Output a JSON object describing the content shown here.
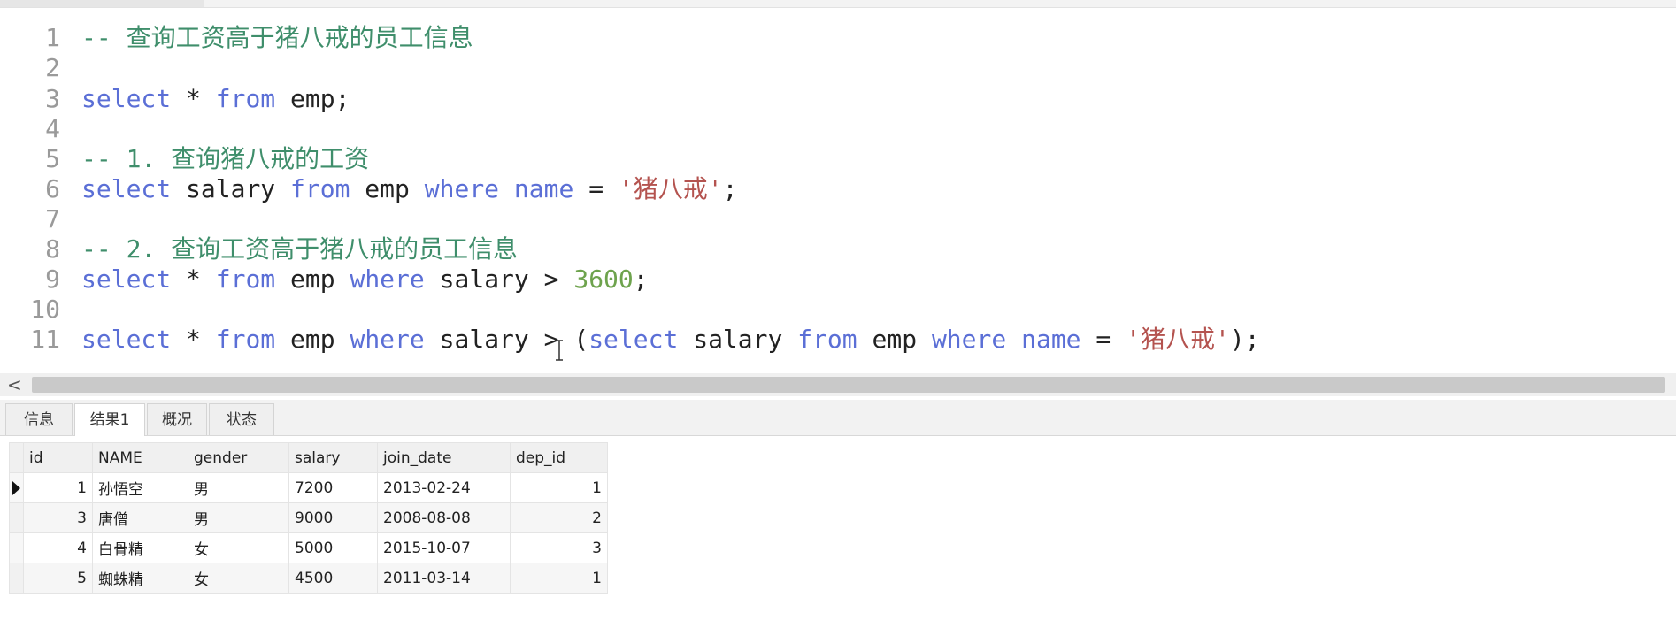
{
  "editor": {
    "lines": [
      {
        "num": "1",
        "tokens": [
          {
            "cls": "cm",
            "text": "-- 查询工资高于猪八戒的员工信息"
          }
        ]
      },
      {
        "num": "2",
        "tokens": []
      },
      {
        "num": "3",
        "tokens": [
          {
            "cls": "kw",
            "text": "select"
          },
          {
            "cls": "tx",
            "text": " * "
          },
          {
            "cls": "kw",
            "text": "from"
          },
          {
            "cls": "tx",
            "text": " emp;"
          }
        ]
      },
      {
        "num": "4",
        "tokens": []
      },
      {
        "num": "5",
        "tokens": [
          {
            "cls": "cm",
            "text": "-- 1. 查询猪八戒的工资"
          }
        ]
      },
      {
        "num": "6",
        "tokens": [
          {
            "cls": "kw",
            "text": "select"
          },
          {
            "cls": "tx",
            "text": " salary "
          },
          {
            "cls": "kw",
            "text": "from"
          },
          {
            "cls": "tx",
            "text": " emp "
          },
          {
            "cls": "kw",
            "text": "where"
          },
          {
            "cls": "tx",
            "text": " "
          },
          {
            "cls": "kw",
            "text": "name"
          },
          {
            "cls": "tx",
            "text": " = "
          },
          {
            "cls": "str",
            "text": "'猪八戒'"
          },
          {
            "cls": "tx",
            "text": ";"
          }
        ]
      },
      {
        "num": "7",
        "tokens": []
      },
      {
        "num": "8",
        "tokens": [
          {
            "cls": "cm",
            "text": "-- 2. 查询工资高于猪八戒的员工信息"
          }
        ]
      },
      {
        "num": "9",
        "tokens": [
          {
            "cls": "kw",
            "text": "select"
          },
          {
            "cls": "tx",
            "text": " * "
          },
          {
            "cls": "kw",
            "text": "from"
          },
          {
            "cls": "tx",
            "text": " emp "
          },
          {
            "cls": "kw",
            "text": "where"
          },
          {
            "cls": "tx",
            "text": " salary > "
          },
          {
            "cls": "num",
            "text": "3600"
          },
          {
            "cls": "tx",
            "text": ";"
          }
        ]
      },
      {
        "num": "10",
        "tokens": []
      },
      {
        "num": "11",
        "tokens": [
          {
            "cls": "kw",
            "text": "select"
          },
          {
            "cls": "tx",
            "text": " * "
          },
          {
            "cls": "kw",
            "text": "from"
          },
          {
            "cls": "tx",
            "text": " emp "
          },
          {
            "cls": "kw",
            "text": "where"
          },
          {
            "cls": "tx",
            "text": " salary > ("
          },
          {
            "cls": "kw",
            "text": "select"
          },
          {
            "cls": "tx",
            "text": " salary "
          },
          {
            "cls": "kw",
            "text": "from"
          },
          {
            "cls": "tx",
            "text": " emp "
          },
          {
            "cls": "kw",
            "text": "where"
          },
          {
            "cls": "tx",
            "text": " "
          },
          {
            "cls": "kw",
            "text": "name"
          },
          {
            "cls": "tx",
            "text": " = "
          },
          {
            "cls": "str",
            "text": "'猪八戒'"
          },
          {
            "cls": "tx",
            "text": ");"
          }
        ]
      }
    ]
  },
  "scrollbar": {
    "left_arrow": "<"
  },
  "tabs": [
    {
      "label": "信息",
      "active": false
    },
    {
      "label": "结果1",
      "active": true
    },
    {
      "label": "概况",
      "active": false
    },
    {
      "label": "状态",
      "active": false
    }
  ],
  "result": {
    "columns": [
      "id",
      "NAME",
      "gender",
      "salary",
      "join_date",
      "dep_id"
    ],
    "rows": [
      [
        "1",
        "孙悟空",
        "男",
        "7200",
        "2013-02-24",
        "1"
      ],
      [
        "3",
        "唐僧",
        "男",
        "9000",
        "2008-08-08",
        "2"
      ],
      [
        "4",
        "白骨精",
        "女",
        "5000",
        "2015-10-07",
        "3"
      ],
      [
        "5",
        "蜘蛛精",
        "女",
        "4500",
        "2011-03-14",
        "1"
      ]
    ],
    "current_row": 0
  },
  "colors": {
    "keyword": "#5b6fd6",
    "comment": "#3f8e6b",
    "string": "#b4534f",
    "number": "#6ea34d",
    "line_number": "#9a9a9a"
  },
  "icons": {
    "row_marker": "current-row-arrow-icon",
    "text_cursor": "i-beam-cursor-icon"
  }
}
